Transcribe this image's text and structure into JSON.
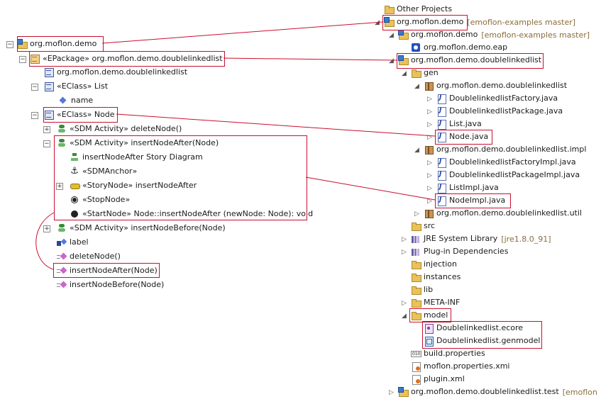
{
  "left_tree": {
    "project": "org.moflon.demo",
    "epackage": "«EPackage» org.moflon.demo.doublelinkedlist",
    "package_sub": "org.moflon.demo.doublelinkedlist",
    "eclass_list": "«EClass» List",
    "attr_name": "name",
    "eclass_node": "«EClass» Node",
    "activity_delete": "«SDM Activity» deleteNode()",
    "activity_insert_after": "«SDM Activity» insertNodeAfter(Node)",
    "story_diagram": "insertNodeAfter Story Diagram",
    "sdm_anchor": "«SDMAnchor»",
    "story_node": "«StoryNode» insertNodeAfter",
    "stop_node": "«StopNode»",
    "start_node": "«StartNode» Node::insertNodeAfter (newNode: Node): void",
    "activity_insert_before": "«SDM Activity» insertNodeBefore(Node)",
    "attr_label": "label",
    "op_delete": "deleteNode()",
    "op_insert_after": "insertNodeAfter(Node)",
    "op_insert_before": "insertNodeBefore(Node)"
  },
  "right_tree": {
    "other_projects": "Other Projects",
    "project_demo": "org.moflon.demo",
    "git_master": "[emoflon-examples master]",
    "sub_demo": "org.moflon.demo",
    "eap_file": "org.moflon.demo.eap",
    "dll_project": "org.moflon.demo.doublelinkedlist",
    "gen": "gen",
    "gen_pkg": "org.moflon.demo.doublelinkedlist",
    "factory": "DoublelinkedlistFactory.java",
    "package_java": "DoublelinkedlistPackage.java",
    "list_java": "List.java",
    "node_java": "Node.java",
    "impl_pkg": "org.moflon.demo.doublelinkedlist.impl",
    "factory_impl": "DoublelinkedlistFactoryImpl.java",
    "package_impl": "DoublelinkedlistPackageImpl.java",
    "list_impl": "ListImpl.java",
    "node_impl": "NodeImpl.java",
    "util_pkg": "org.moflon.demo.doublelinkedlist.util",
    "src": "src",
    "jre": "JRE System Library",
    "jre_version": "[jre1.8.0_91]",
    "plugin_deps": "Plug-in Dependencies",
    "injection": "injection",
    "instances": "instances",
    "lib": "lib",
    "meta_inf": "META-INF",
    "model": "model",
    "ecore": "Doublelinkedlist.ecore",
    "genmodel": "Doublelinkedlist.genmodel",
    "build_props": "build.properties",
    "moflon_props": "moflon.properties.xmi",
    "plugin_xml": "plugin.xml",
    "test_project": "org.moflon.demo.doublelinkedlist.test",
    "test_git": "[emoflon"
  },
  "colors": {
    "highlight": "#c8102e",
    "git_label": "#8a6d3b"
  }
}
